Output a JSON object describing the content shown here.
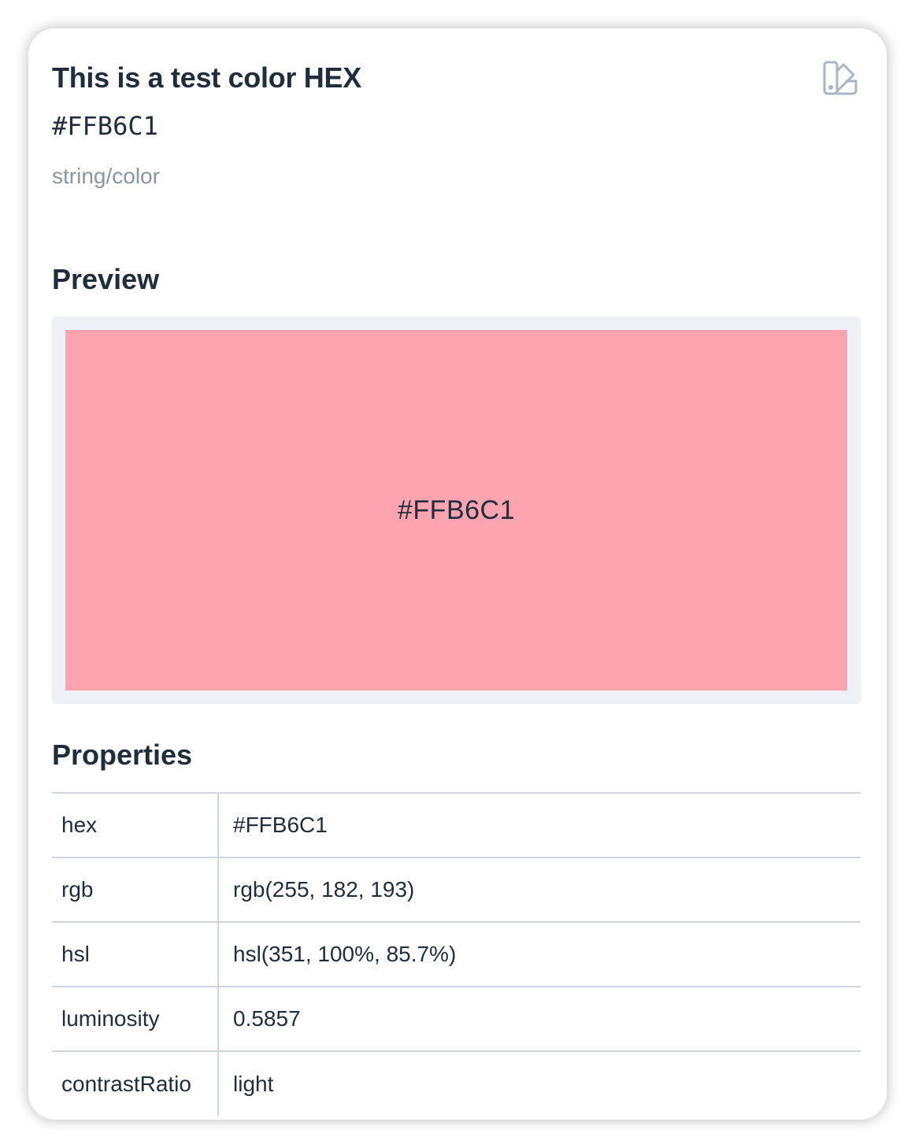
{
  "token": {
    "title": "This is a test color HEX",
    "value": "#FFB6C1",
    "type": "string/color",
    "icon": "color-swatch-icon"
  },
  "preview": {
    "heading": "Preview",
    "label": "#FFB6C1",
    "swatch_color": "#FDA4B0"
  },
  "properties": {
    "heading": "Properties",
    "rows": [
      {
        "key": "hex",
        "value": "#FFB6C1"
      },
      {
        "key": "rgb",
        "value": "rgb(255, 182, 193)"
      },
      {
        "key": "hsl",
        "value": "hsl(351, 100%, 85.7%)"
      },
      {
        "key": "luminosity",
        "value": "0.5857"
      },
      {
        "key": "contrastRatio",
        "value": "light"
      }
    ]
  },
  "colors": {
    "text": "#1f2d3d",
    "muted": "#8a95a3",
    "frame": "#eef2f6",
    "border": "#cfd6de",
    "icon": "#a9b6c6"
  }
}
